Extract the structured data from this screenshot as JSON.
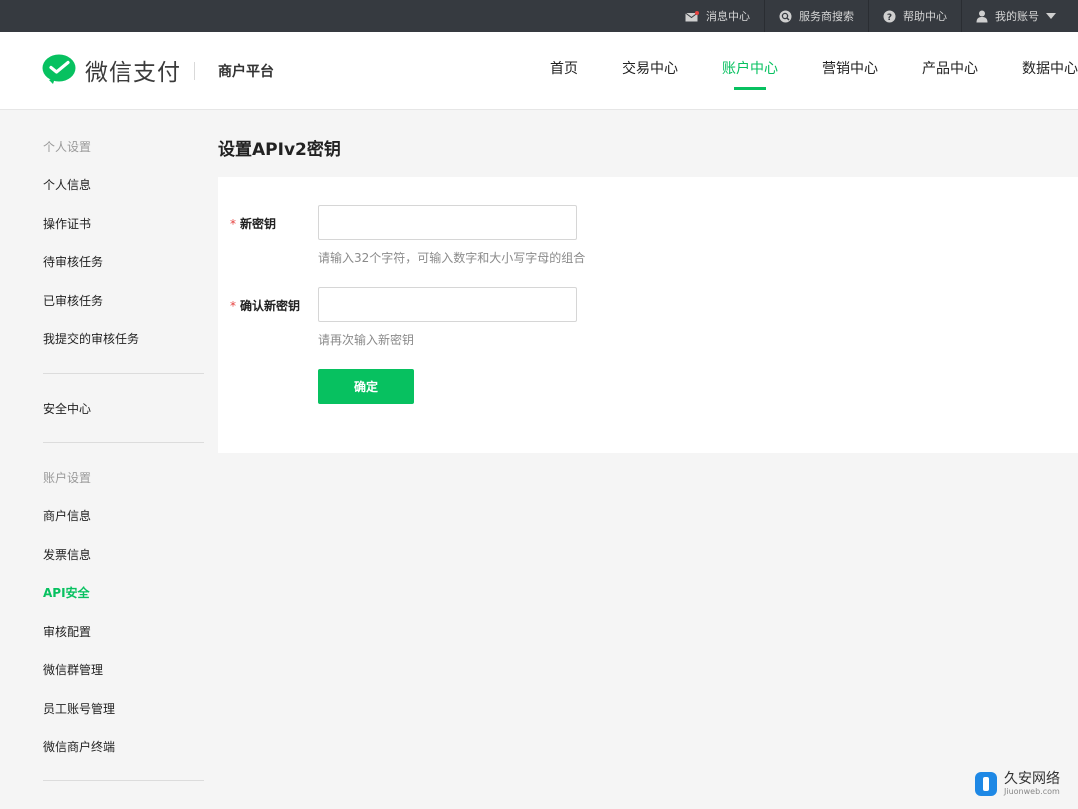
{
  "topbar": {
    "items": [
      {
        "label": "消息中心",
        "icon": "message-icon"
      },
      {
        "label": "服务商搜索",
        "icon": "search-icon"
      },
      {
        "label": "帮助中心",
        "icon": "help-icon"
      },
      {
        "label": "我的账号",
        "icon": "user-icon"
      }
    ]
  },
  "header": {
    "logo_text": "微信支付",
    "platform": "商户平台",
    "nav": [
      {
        "label": "首页",
        "active": false
      },
      {
        "label": "交易中心",
        "active": false
      },
      {
        "label": "账户中心",
        "active": true
      },
      {
        "label": "营销中心",
        "active": false
      },
      {
        "label": "产品中心",
        "active": false
      },
      {
        "label": "数据中心",
        "active": false
      }
    ]
  },
  "sidebar": {
    "section1_title": "个人设置",
    "section1_items": [
      "个人信息",
      "操作证书",
      "待审核任务",
      "已审核任务",
      "我提交的审核任务"
    ],
    "security_item": "安全中心",
    "section2_title": "账户设置",
    "section2_items": [
      "商户信息",
      "发票信息",
      "API安全",
      "审核配置",
      "微信群管理",
      "员工账号管理",
      "微信商户终端"
    ],
    "active_item": "API安全"
  },
  "main": {
    "title": "设置APIv2密钥",
    "form": {
      "required_mark": "*",
      "new_key_label": "新密钥",
      "new_key_value": "",
      "new_key_hint": "请输入32个字符，可输入数字和大小写字母的组合",
      "confirm_key_label": "确认新密钥",
      "confirm_key_value": "",
      "confirm_key_hint": "请再次输入新密钥",
      "submit_label": "确定"
    }
  },
  "watermark": {
    "main": "久安网络",
    "sub": "Jiuonweb.com"
  },
  "colors": {
    "accent": "#07c160",
    "topbar_bg": "#363a40",
    "required": "#e64340"
  }
}
